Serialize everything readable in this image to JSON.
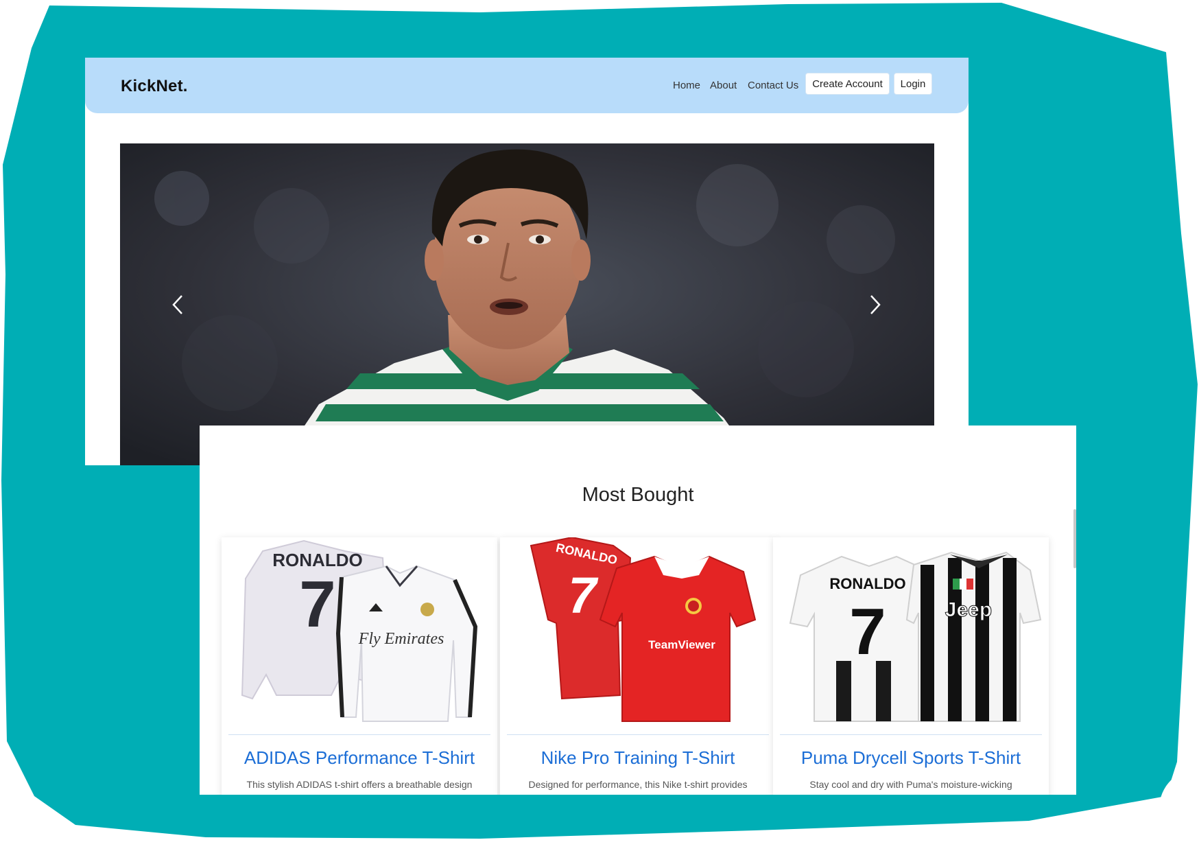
{
  "navbar": {
    "brand": "KickNet.",
    "links": [
      "Home",
      "About",
      "Contact Us"
    ],
    "create_account": "Create Account",
    "login": "Login"
  },
  "carousel": {
    "prev_icon": "chevron-left-icon",
    "next_icon": "chevron-right-icon"
  },
  "section": {
    "title": "Most Bought"
  },
  "products": [
    {
      "title": "ADIDAS Performance T-Shirt",
      "desc": "This stylish ADIDAS t-shirt offers a breathable design perfect for active wear."
    },
    {
      "title": "Nike Pro Training T-Shirt",
      "desc": "Designed for performance, this Nike t-shirt provides flexibility and comfort during workouts."
    },
    {
      "title": "Puma Drycell Sports T-Shirt",
      "desc": "Stay cool and dry with Puma's moisture-wicking technology, ideal for intense activities."
    }
  ],
  "jerseys": {
    "name": "RONALDO",
    "number": "7",
    "sponsor_1": "Fly Emirates",
    "sponsor_2": "TeamViewer",
    "sponsor_3": "Jeep"
  },
  "colors": {
    "backdrop": "#00aeb5",
    "navbar": "#b8dcfa",
    "link": "#1c6ed6"
  }
}
